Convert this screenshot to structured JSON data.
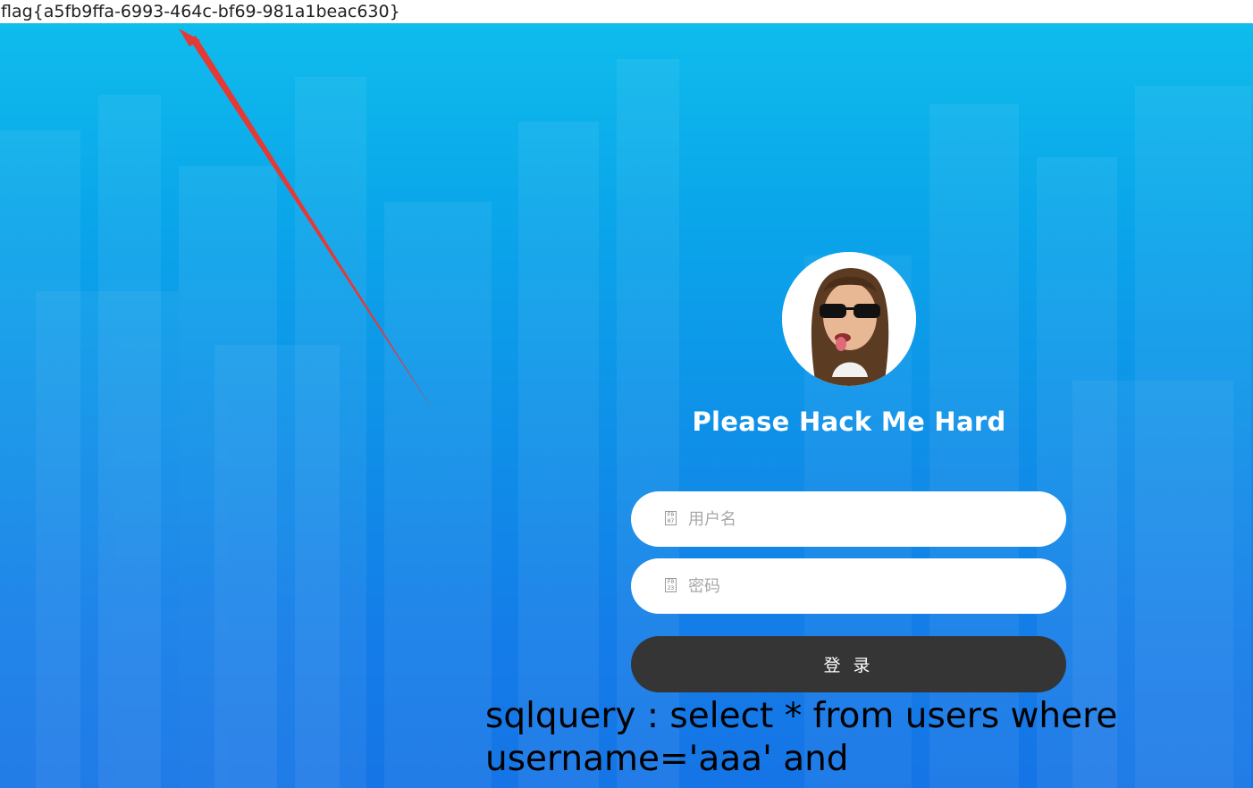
{
  "flag_text": "flag{a5fb9ffa-6993-464c-bf69-981a1beac630}",
  "login": {
    "title": "Please Hack Me Hard",
    "username_placeholder": "用户名",
    "password_placeholder": "密码",
    "submit_label": "登 录",
    "icon_name": "missing-glyph-icon"
  },
  "sql": {
    "line1": "sqlquery : select * from users where",
    "line2": "username='aaa' and"
  },
  "colors": {
    "background_top": "#0fbcec",
    "background_bottom": "#1574e6",
    "button": "#353535",
    "arrow": "#e53935"
  }
}
